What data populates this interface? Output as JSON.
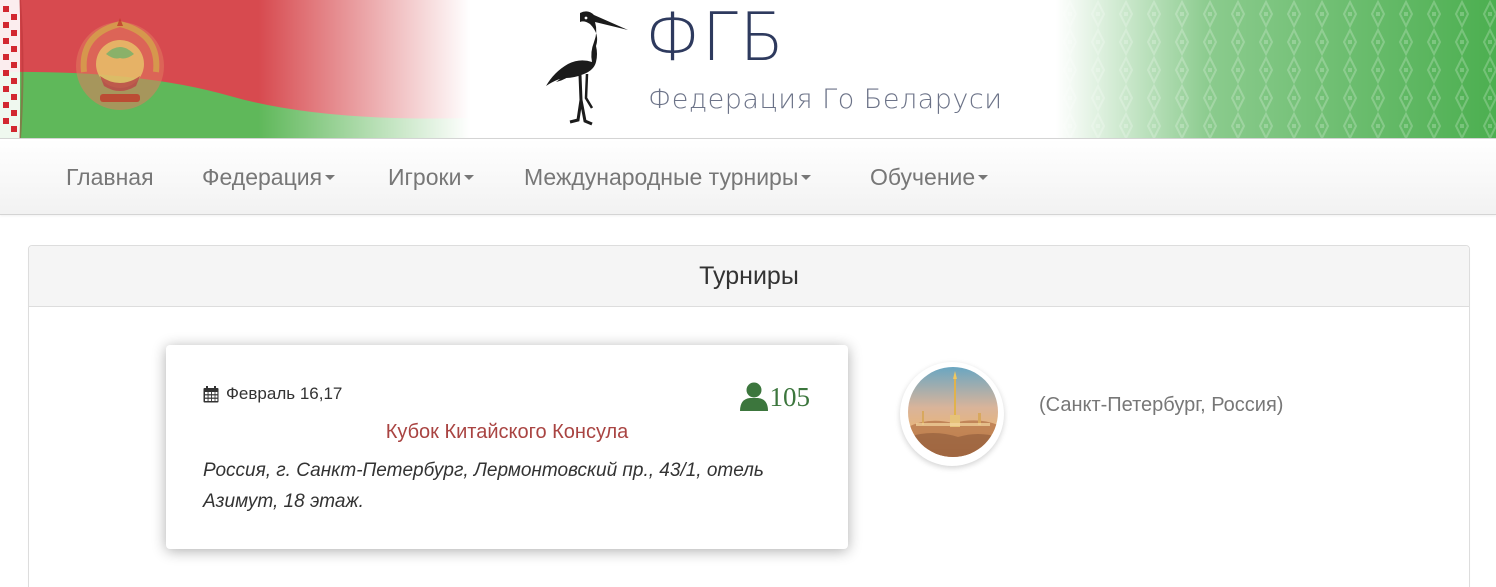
{
  "header": {
    "logo_abbr": "ФГБ",
    "logo_full": "Федерация Го Беларуси"
  },
  "nav": {
    "items": [
      {
        "label": "Главная",
        "dropdown": false
      },
      {
        "label": "Федерация",
        "dropdown": true
      },
      {
        "label": "Игроки",
        "dropdown": true
      },
      {
        "label": "Международные турниры",
        "dropdown": true
      },
      {
        "label": "Обучение",
        "dropdown": true
      }
    ]
  },
  "panel": {
    "title": "Турниры"
  },
  "tournament": {
    "date": "Февраль 16,17",
    "players_count": "105",
    "title": "Кубок Китайского Консула",
    "address": "Россия, г. Санкт-Петербург, Лермонтовский пр., 43/1, отель Азимут, 18 этаж.",
    "city_label": "(Санкт-Петербург, Россия)"
  },
  "colors": {
    "title_link": "#a94442",
    "players": "#3c763d",
    "nav_text": "#777777",
    "flag_red": "#d22730",
    "flag_green": "#4aa657"
  },
  "icons": {
    "date": "calendar-icon",
    "players": "user-icon",
    "nav_dropdown": "caret-down-icon"
  }
}
